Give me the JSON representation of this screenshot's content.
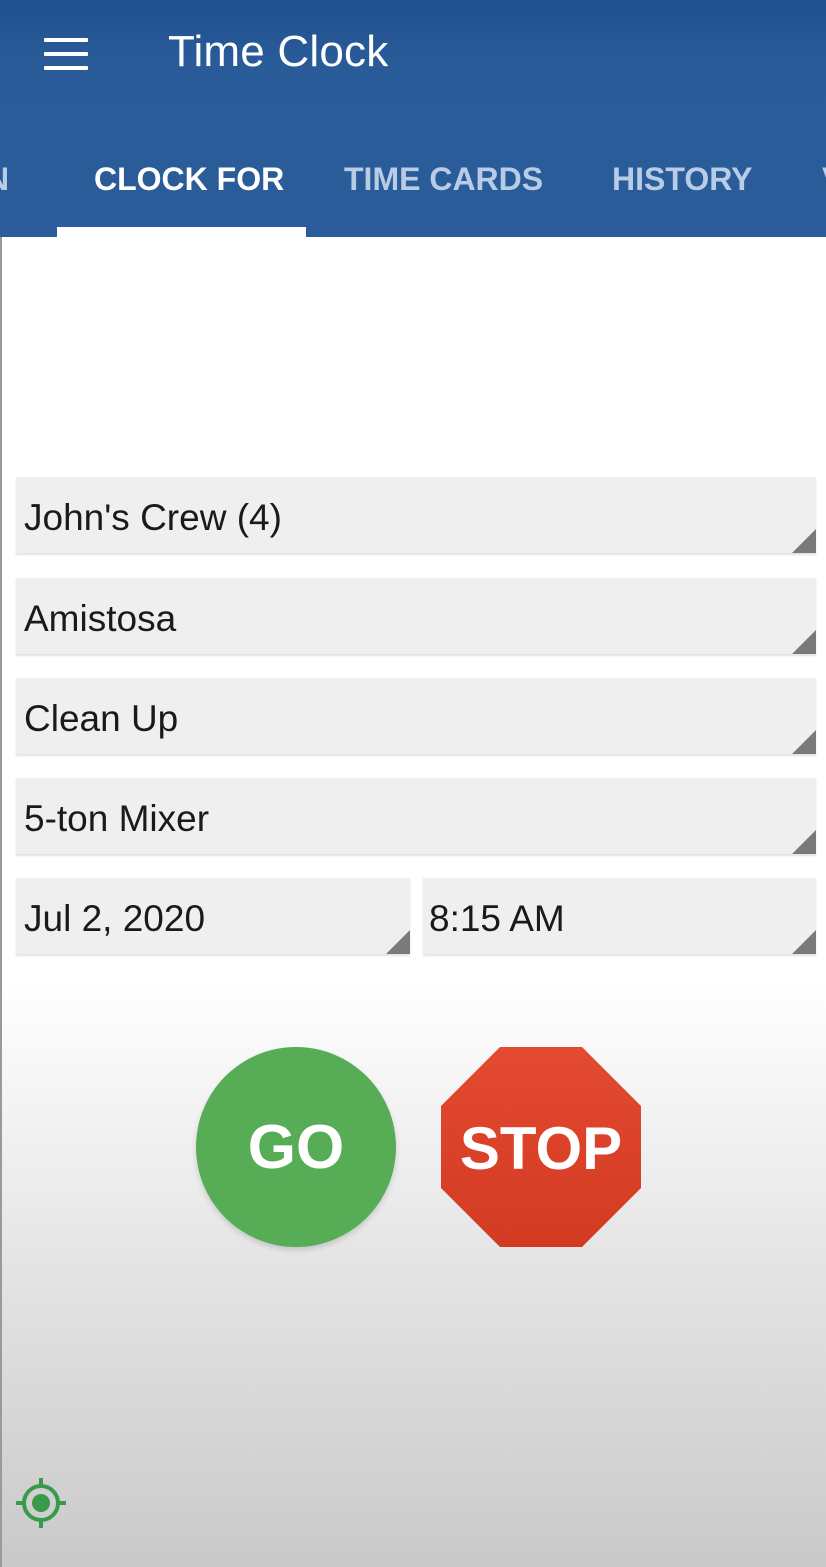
{
  "app": {
    "title": "Time Clock",
    "menu_icon": "hamburger-menu-icon",
    "primary_color": "#2b5c9b"
  },
  "tabs": [
    {
      "label": "N",
      "active": false
    },
    {
      "label": "CLOCK FOR",
      "active": true
    },
    {
      "label": "TIME CARDS",
      "active": false
    },
    {
      "label": "HISTORY",
      "active": false
    },
    {
      "label": "V",
      "active": false
    }
  ],
  "form": {
    "crew": "John's Crew (4)",
    "job": "Amistosa",
    "task": "Clean Up",
    "equipment": "5-ton Mixer",
    "date": "Jul 2, 2020",
    "time": "8:15 AM"
  },
  "actions": {
    "go_label": "GO",
    "go_color": "#56ad56",
    "stop_label": "STOP",
    "stop_color": "#e0402a"
  },
  "footer": {
    "location_icon": "location-target-icon",
    "location_color": "#3a9a4a"
  }
}
